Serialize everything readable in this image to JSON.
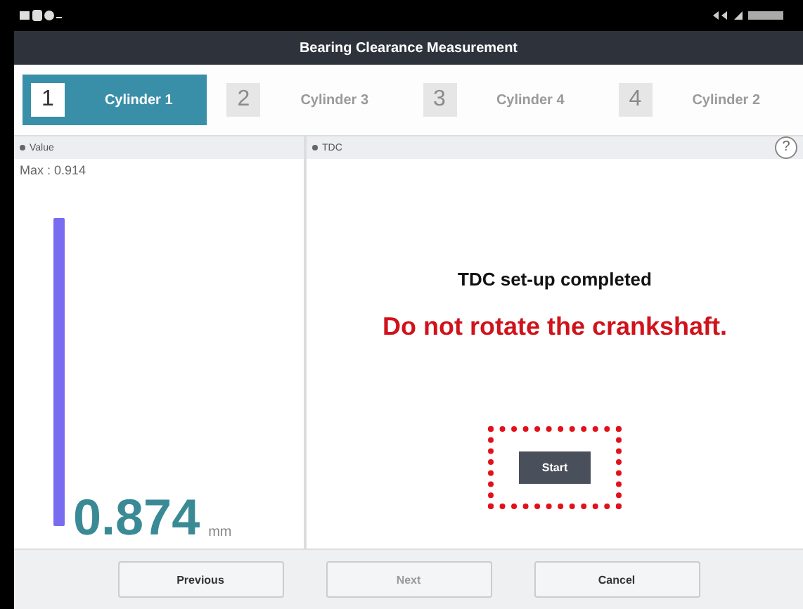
{
  "title_bar": {
    "title": "Bearing Clearance Measurement"
  },
  "steps": [
    {
      "number": "1",
      "label": "Cylinder 1",
      "selected": true
    },
    {
      "number": "2",
      "label": "Cylinder 3",
      "selected": false
    },
    {
      "number": "3",
      "label": "Cylinder 4",
      "selected": false
    },
    {
      "number": "4",
      "label": "Cylinder 2",
      "selected": false
    }
  ],
  "value_panel": {
    "header": "Value",
    "max": "Max : 0.914",
    "reading": "0.874",
    "unit": "mm"
  },
  "tdc_panel": {
    "header": "TDC",
    "help": "?",
    "status": "TDC set-up completed",
    "warning": "Do not rotate the crankshaft.",
    "start_button": {
      "label": "Start",
      "highlighted": true
    }
  },
  "footer_buttons": [
    {
      "label": "Previous",
      "disabled": false
    },
    {
      "label": "Next",
      "disabled": true
    },
    {
      "label": "Cancel",
      "disabled": false
    }
  ]
}
